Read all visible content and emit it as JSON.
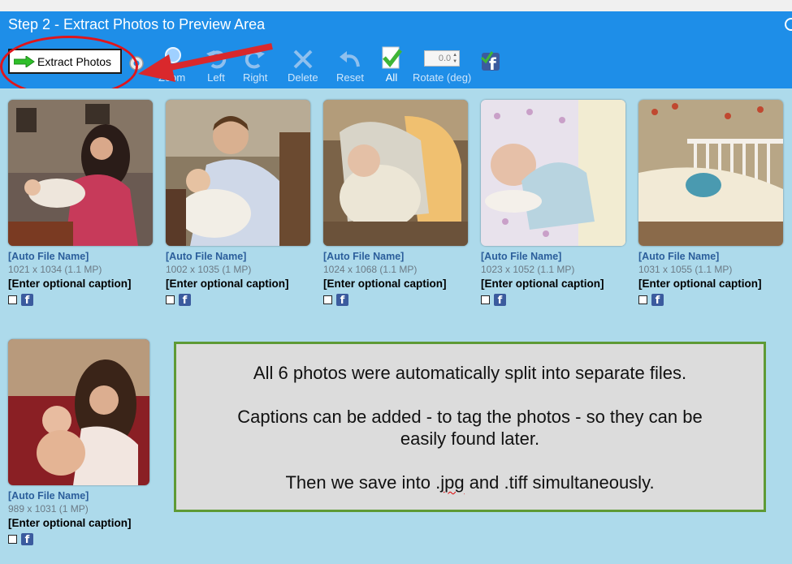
{
  "header": {
    "title": "Step 2 - Extract Photos to Preview Area",
    "extract_label": "Extract Photos",
    "tools": {
      "zoom": "Zoom",
      "left": "Left",
      "right": "Right",
      "delete": "Delete",
      "reset": "Reset",
      "all": "All",
      "rotate": "Rotate (deg)"
    },
    "rotate_value": "0.0"
  },
  "photos": [
    {
      "filename": "[Auto File Name]",
      "dims": "1021 x 1034 (1.1 MP)",
      "caption": "[Enter optional caption]"
    },
    {
      "filename": "[Auto File Name]",
      "dims": "1002 x 1035 (1 MP)",
      "caption": "[Enter optional caption]"
    },
    {
      "filename": "[Auto File Name]",
      "dims": "1024 x 1068 (1.1 MP)",
      "caption": "[Enter optional caption]"
    },
    {
      "filename": "[Auto File Name]",
      "dims": "1023 x 1052 (1.1 MP)",
      "caption": "[Enter optional caption]"
    },
    {
      "filename": "[Auto File Name]",
      "dims": "1031 x 1055 (1.1 MP)",
      "caption": "[Enter optional caption]"
    },
    {
      "filename": "[Auto File Name]",
      "dims": "989 x 1031 (1 MP)",
      "caption": "[Enter optional caption]"
    }
  ],
  "note": {
    "line1": "All 6 photos were automatically split into separate files.",
    "line2": "Captions can be added - to tag the photos - so they can be",
    "line3": "easily found later.",
    "line4_a": "Then we save into .",
    "line4_b": "jpg",
    "line4_c": " and .tiff simultaneously."
  },
  "colors": {
    "header_bg": "#1e8ee8",
    "content_bg": "#addaeb",
    "highlight": "#e0151b",
    "note_border": "#5e9a35"
  }
}
